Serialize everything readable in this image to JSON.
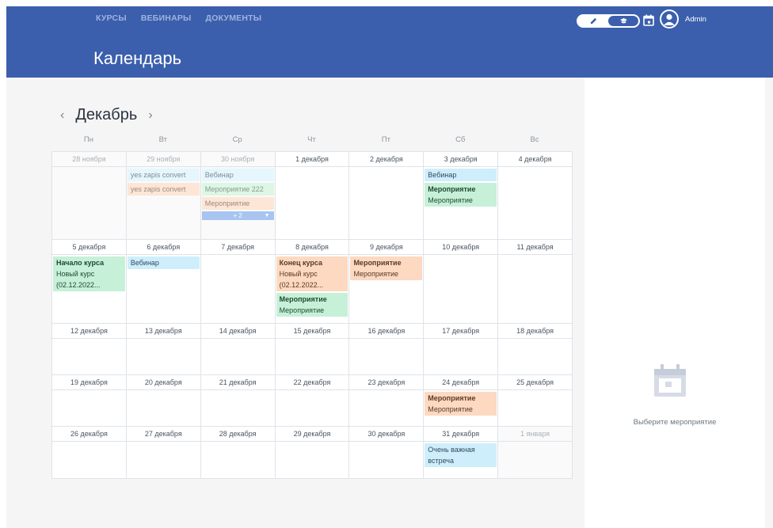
{
  "nav": {
    "items": [
      "КУРСЫ",
      "ВЕБИНАРЫ",
      "ДОКУМЕНТЫ"
    ]
  },
  "header": {
    "title": "Календарь",
    "username": "Admin"
  },
  "calendar": {
    "month": "Декабрь",
    "weekdays": [
      "Пн",
      "Вт",
      "Ср",
      "Чт",
      "Пт",
      "Сб",
      "Вс"
    ],
    "weeks": [
      [
        {
          "date": "28 ноября",
          "other": true,
          "events": []
        },
        {
          "date": "29 ноября",
          "other": true,
          "events": [
            {
              "text": "yes zapis convert",
              "color": "muted-blue"
            },
            {
              "text": "yes zapis convert",
              "color": "muted-orange"
            }
          ]
        },
        {
          "date": "30 ноября",
          "other": true,
          "more": "+ 2",
          "events": [
            {
              "text": "Вебинар",
              "color": "muted-blue"
            },
            {
              "text": "Мероприятие 222",
              "color": "muted-green"
            },
            {
              "text": "Мероприятие",
              "color": "muted-orange"
            }
          ]
        },
        {
          "date": "1 декабря",
          "events": []
        },
        {
          "date": "2 декабря",
          "events": []
        },
        {
          "date": "3 декабря",
          "events": [
            {
              "text": "Вебинар",
              "color": "blue"
            },
            {
              "title": "Мероприятие",
              "text": "Мероприятие",
              "color": "green"
            }
          ]
        },
        {
          "date": "4 декабря",
          "events": []
        }
      ],
      [
        {
          "date": "5 декабря",
          "events": [
            {
              "title": "Начало курса",
              "text": "Новый курс (02.12.2022...",
              "color": "green"
            }
          ]
        },
        {
          "date": "6 декабря",
          "events": [
            {
              "text": "Вебинар",
              "color": "blue"
            }
          ]
        },
        {
          "date": "7 декабря",
          "events": []
        },
        {
          "date": "8 декабря",
          "events": [
            {
              "title": "Конец курса",
              "text": "Новый курс (02.12.2022...",
              "color": "orange"
            },
            {
              "title": "Мероприятие",
              "text": "Мероприятие",
              "color": "green"
            }
          ]
        },
        {
          "date": "9 декабря",
          "events": [
            {
              "title": "Мероприятие",
              "text": "Мероприятие",
              "color": "orange"
            }
          ]
        },
        {
          "date": "10 декабря",
          "events": []
        },
        {
          "date": "11 декабря",
          "events": []
        }
      ],
      [
        {
          "date": "12 декабря",
          "events": []
        },
        {
          "date": "13 декабря",
          "events": []
        },
        {
          "date": "14 декабря",
          "events": []
        },
        {
          "date": "15 декабря",
          "events": []
        },
        {
          "date": "16 декабря",
          "events": []
        },
        {
          "date": "17 декабря",
          "events": []
        },
        {
          "date": "18 декабря",
          "events": []
        }
      ],
      [
        {
          "date": "19 декабря",
          "events": []
        },
        {
          "date": "20 декабря",
          "events": []
        },
        {
          "date": "21 декабря",
          "events": []
        },
        {
          "date": "22 декабря",
          "events": []
        },
        {
          "date": "23 декабря",
          "events": []
        },
        {
          "date": "24 декабря",
          "events": [
            {
              "title": "Мероприятие",
              "text": "Мероприятие",
              "color": "orange"
            }
          ]
        },
        {
          "date": "25 декабря",
          "events": []
        }
      ],
      [
        {
          "date": "26 декабря",
          "events": []
        },
        {
          "date": "27 декабря",
          "events": []
        },
        {
          "date": "28 декабря",
          "events": []
        },
        {
          "date": "29 декабря",
          "events": []
        },
        {
          "date": "30 декабря",
          "events": []
        },
        {
          "date": "31 декабря",
          "events": [
            {
              "text": "Очень важная встреча",
              "color": "blue"
            }
          ]
        },
        {
          "date": "1 января",
          "other": true,
          "events": []
        }
      ]
    ]
  },
  "side_panel": {
    "empty_text": "Выберите мероприятие"
  },
  "icons": {
    "prev": "‹",
    "next": "›",
    "toggle_left": "pencil-icon",
    "toggle_right": "graduation-cap-icon",
    "calendar": "calendar-icon",
    "avatar": "user-avatar-icon"
  },
  "colors": {
    "header": "#3b5fad",
    "event_blue": "#cfeefc",
    "event_green": "#c6f0d8",
    "event_orange": "#fcd9c0",
    "more": "#a8c4f0"
  }
}
